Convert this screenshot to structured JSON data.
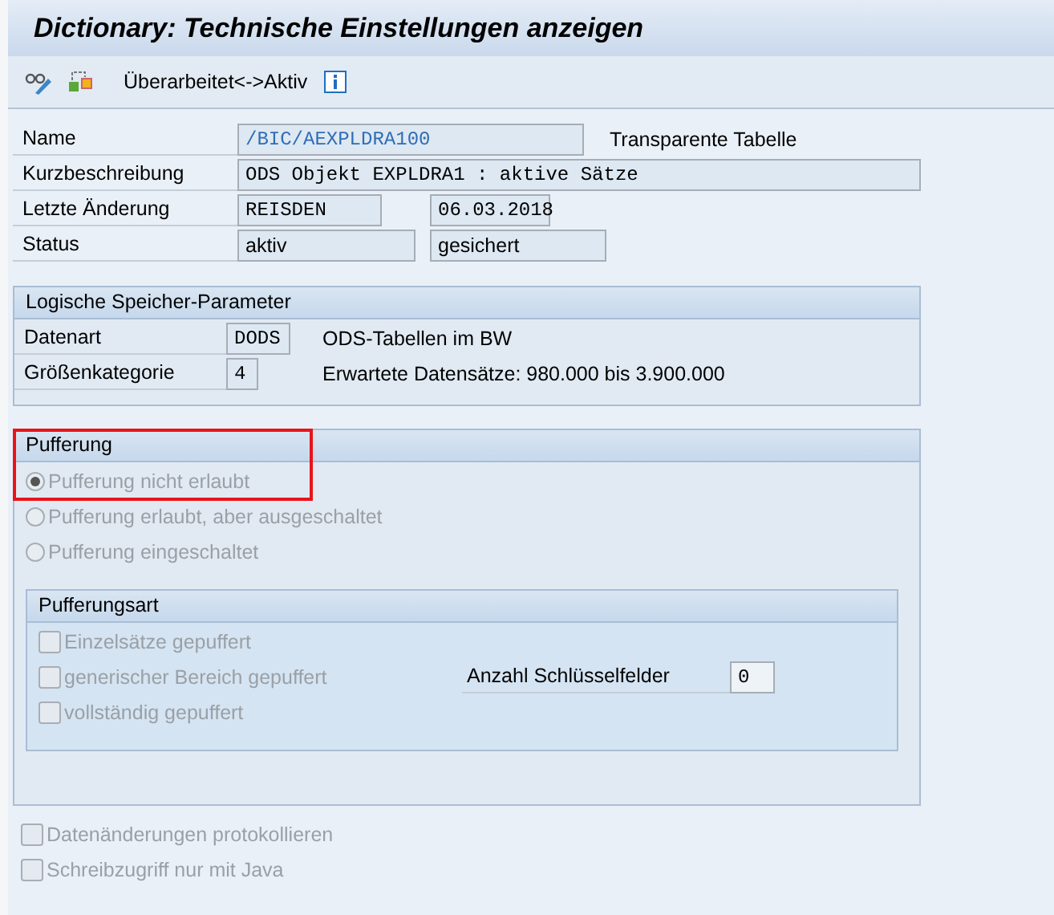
{
  "window": {
    "title": "Dictionary: Technische Einstellungen anzeigen"
  },
  "toolbar": {
    "toggle_button": "Überarbeitet<->Aktiv"
  },
  "header_fields": [
    {
      "label": "Name",
      "fields": [
        {
          "value": "/BIC/AEXPLDRA100",
          "kind": "mono",
          "link": true
        }
      ],
      "note": "Transparente Tabelle"
    },
    {
      "label": "Kurzbeschreibung",
      "fields": [
        {
          "value": "ODS Objekt EXPLDRA1 : aktive Sätze",
          "kind": "mono",
          "link": false
        }
      ]
    },
    {
      "label": "Letzte Änderung",
      "fields": [
        {
          "value": "REISDEN",
          "kind": "mono",
          "link": false
        },
        {
          "value": "06.03.2018",
          "kind": "mono",
          "link": false
        }
      ]
    },
    {
      "label": "Status",
      "fields": [
        {
          "value": "aktiv",
          "kind": "plain",
          "link": false
        },
        {
          "value": "gesichert",
          "kind": "plain",
          "link": false
        }
      ]
    }
  ],
  "storage_group": {
    "title": "Logische Speicher-Parameter",
    "rows": [
      {
        "label": "Datenart",
        "value": "DODS",
        "note": "ODS-Tabellen im BW"
      },
      {
        "label": "Größenkategorie",
        "value": "4",
        "note": "Erwartete Datensätze: 980.000 bis 3.900.000"
      }
    ]
  },
  "buffering_group": {
    "title": "Pufferung",
    "highlighted": true,
    "options": [
      {
        "label": "Pufferung nicht erlaubt",
        "selected": true,
        "disabled": true
      },
      {
        "label": "Pufferung erlaubt, aber ausgeschaltet",
        "selected": false,
        "disabled": true
      },
      {
        "label": "Pufferung eingeschaltet",
        "selected": false,
        "disabled": true
      }
    ],
    "buffer_type": {
      "title": "Pufferungsart",
      "options": [
        {
          "label": "Einzelsätze gepuffert",
          "checked": false,
          "disabled": true
        },
        {
          "label": "generischer Bereich gepuffert",
          "checked": false,
          "disabled": true
        },
        {
          "label": "vollständig gepuffert",
          "checked": false,
          "disabled": true
        }
      ],
      "key_fields": {
        "label": "Anzahl Schlüsselfelder",
        "value": "0"
      }
    }
  },
  "bottom_options": [
    {
      "label": "Datenänderungen protokollieren",
      "checked": false,
      "disabled": true
    },
    {
      "label": "Schreibzugriff nur mit Java",
      "checked": false,
      "disabled": true
    }
  ]
}
